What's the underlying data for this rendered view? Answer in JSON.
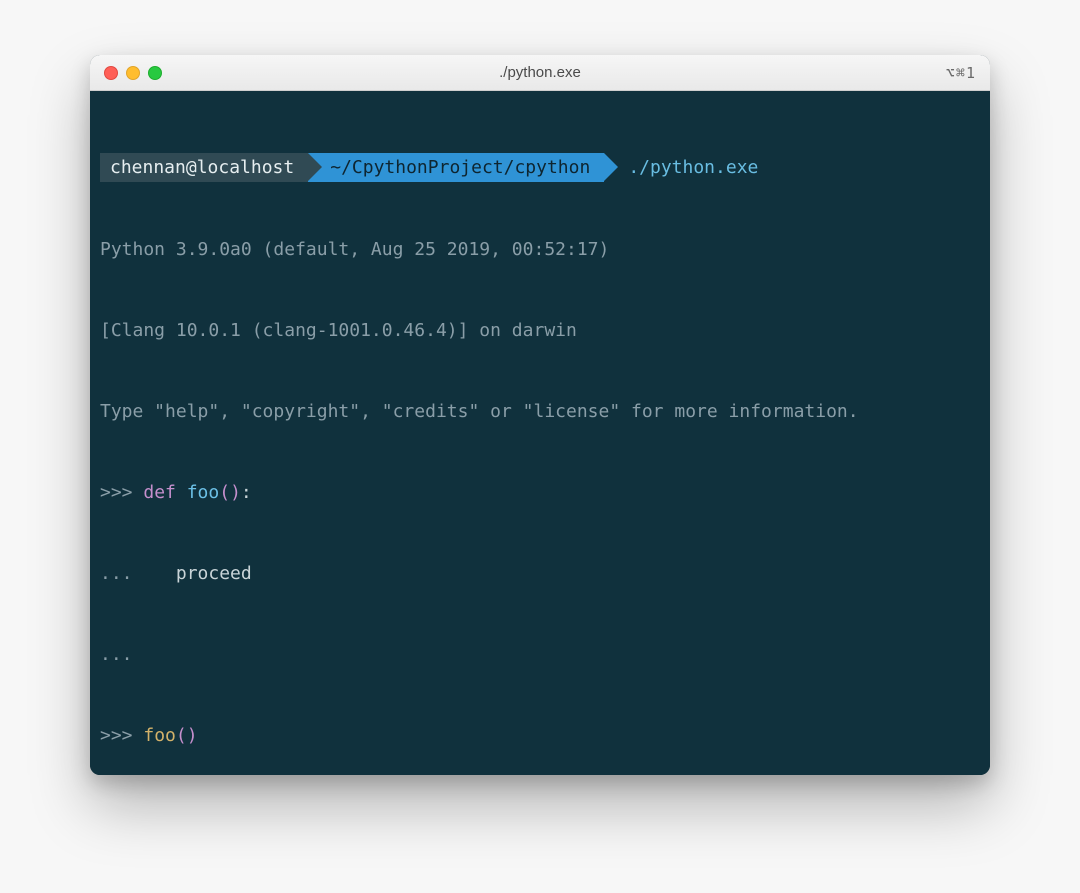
{
  "window": {
    "title": "./python.exe",
    "shortcut": "⌥⌘1"
  },
  "prompt": {
    "user": "chennan@localhost",
    "path": "~/CpythonProject/cpython",
    "command": "./python.exe"
  },
  "output": {
    "ver": "Python 3.9.0a0 (default, Aug 25 2019, 00:52:17)",
    "clang": "[Clang 10.0.1 (clang-1001.0.46.4)] on darwin",
    "help": "Type \"help\", \"copyright\", \"credits\" or \"license\" for more information.",
    "p1a": ">>> ",
    "def_kw": "def",
    "sp": " ",
    "foo": "foo",
    "paren": "()",
    "colon": ":",
    "p2": "...    ",
    "proceed": "proceed",
    "p3": "...",
    "p4": ">>> ",
    "callparen": "()",
    "p5": ">>> "
  }
}
